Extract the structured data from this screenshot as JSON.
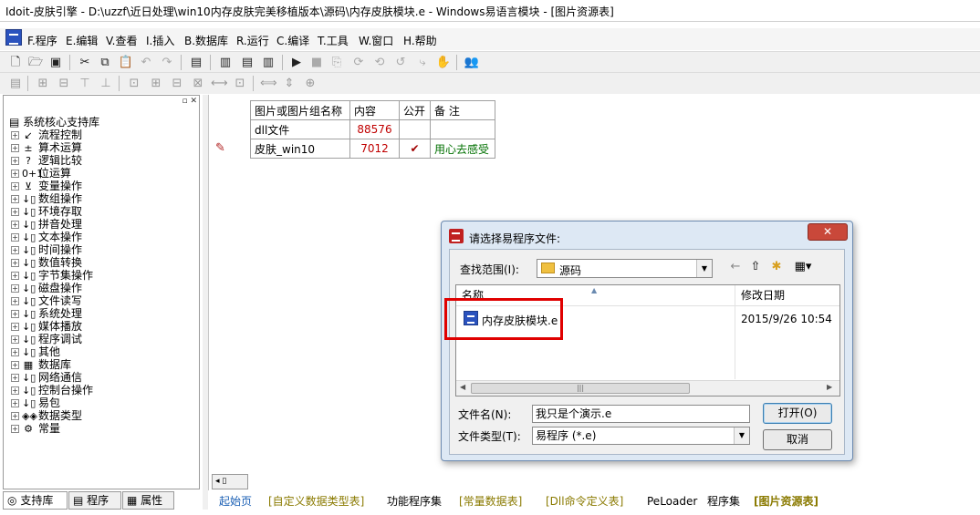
{
  "window": {
    "title": "Idoit-皮肤引擎 - D:\\uzzf\\近日处理\\win10内存皮肤完美移植版本\\源码\\内存皮肤模块.e - Windows易语言模块 - [图片资源表]"
  },
  "menu": [
    "F.程序",
    "E.编辑",
    "V.查看",
    "I.插入",
    "B.数据库",
    "R.运行",
    "C.编译",
    "T.工具",
    "W.窗口",
    "H.帮助"
  ],
  "toolbar": {
    "row1_icons": [
      "new-icon",
      "open-icon",
      "save-icon",
      "cut-icon",
      "copy-icon",
      "paste-icon",
      "undo-icon",
      "redo-icon",
      "find-icon",
      "layout-1-icon",
      "layout-2-icon",
      "layout-3-icon",
      "run-icon",
      "stop-icon",
      "step-icon",
      "step-into-icon",
      "step-out-icon",
      "run-to-cursor-icon",
      "hand-icon",
      "people-icon"
    ],
    "row2_icons": [
      "align-left-icon",
      "align-center-icon",
      "align-right-icon",
      "align-top-icon",
      "align-middle-icon",
      "align-bottom-icon",
      "space-h-icon",
      "space-v-icon",
      "size-w-icon",
      "size-h-icon",
      "center-icon"
    ]
  },
  "support_panel": {
    "root": "系统核心支持库",
    "items": [
      {
        "label": "流程控制",
        "icon": "arrow-icon",
        "glyph": "↙"
      },
      {
        "label": "算术运算",
        "icon": "math-icon",
        "glyph": "±"
      },
      {
        "label": "逻辑比较",
        "icon": "question-icon",
        "glyph": "?"
      },
      {
        "label": "位运算",
        "icon": "bits-icon",
        "glyph": "0+1"
      },
      {
        "label": "变量操作",
        "icon": "variable-icon",
        "glyph": "⊻"
      },
      {
        "label": "数组操作",
        "icon": "command-icon",
        "glyph": "↓▯"
      },
      {
        "label": "环境存取",
        "icon": "command-icon",
        "glyph": "↓▯"
      },
      {
        "label": "拼音处理",
        "icon": "command-icon",
        "glyph": "↓▯"
      },
      {
        "label": "文本操作",
        "icon": "command-icon",
        "glyph": "↓▯"
      },
      {
        "label": "时间操作",
        "icon": "command-icon",
        "glyph": "↓▯"
      },
      {
        "label": "数值转换",
        "icon": "command-icon",
        "glyph": "↓▯"
      },
      {
        "label": "字节集操作",
        "icon": "command-icon",
        "glyph": "↓▯"
      },
      {
        "label": "磁盘操作",
        "icon": "command-icon",
        "glyph": "↓▯"
      },
      {
        "label": "文件读写",
        "icon": "command-icon",
        "glyph": "↓▯"
      },
      {
        "label": "系统处理",
        "icon": "command-icon",
        "glyph": "↓▯"
      },
      {
        "label": "媒体播放",
        "icon": "command-icon",
        "glyph": "↓▯"
      },
      {
        "label": "程序调试",
        "icon": "command-icon",
        "glyph": "↓▯"
      },
      {
        "label": "其他",
        "icon": "command-icon",
        "glyph": "↓▯"
      },
      {
        "label": "数据库",
        "icon": "database-icon",
        "glyph": "▦"
      },
      {
        "label": "网络通信",
        "icon": "command-icon",
        "glyph": "↓▯"
      },
      {
        "label": "控制台操作",
        "icon": "command-icon",
        "glyph": "↓▯"
      },
      {
        "label": "易包",
        "icon": "command-icon",
        "glyph": "↓▯"
      },
      {
        "label": "数据类型",
        "icon": "datatype-icon",
        "glyph": "◈◈"
      },
      {
        "label": "常量",
        "icon": "constant-icon",
        "glyph": "⚙"
      }
    ],
    "tabs": [
      "支持库",
      "程序",
      "属性"
    ]
  },
  "resource_table": {
    "headers": [
      "图片或图片组名称",
      "内容",
      "公开",
      "备 注"
    ],
    "rows": [
      {
        "name": "dll文件",
        "content": "88576",
        "public": "",
        "note": ""
      },
      {
        "name": "皮肤_win10",
        "content": "7012",
        "public": "✔",
        "note": "用心去感受"
      }
    ]
  },
  "editor_tabs": [
    "起始页",
    "[自定义数据类型表]",
    "功能程序集",
    "[常量数据表]",
    "[Dll命令定义表]",
    "PeLoader",
    "程序集",
    "[图片资源表]"
  ],
  "dialog": {
    "title": "请选择易程序文件:",
    "close": "✕",
    "look_in_label": "查找范围(I):",
    "look_in_value": "源码",
    "columns": {
      "name": "名称",
      "modified": "修改日期"
    },
    "file": {
      "name": "内存皮肤模块.e",
      "modified": "2015/9/26 10:54"
    },
    "file_name_label": "文件名(N):",
    "file_name_value": "我只是个演示.e",
    "file_type_label": "文件类型(T):",
    "file_type_value": "易程序 (*.e)",
    "open_button": "打开(O)",
    "cancel_button": "取消"
  },
  "colors": {
    "highlight": "#e00000",
    "number": "#c00000",
    "note": "#007000"
  }
}
